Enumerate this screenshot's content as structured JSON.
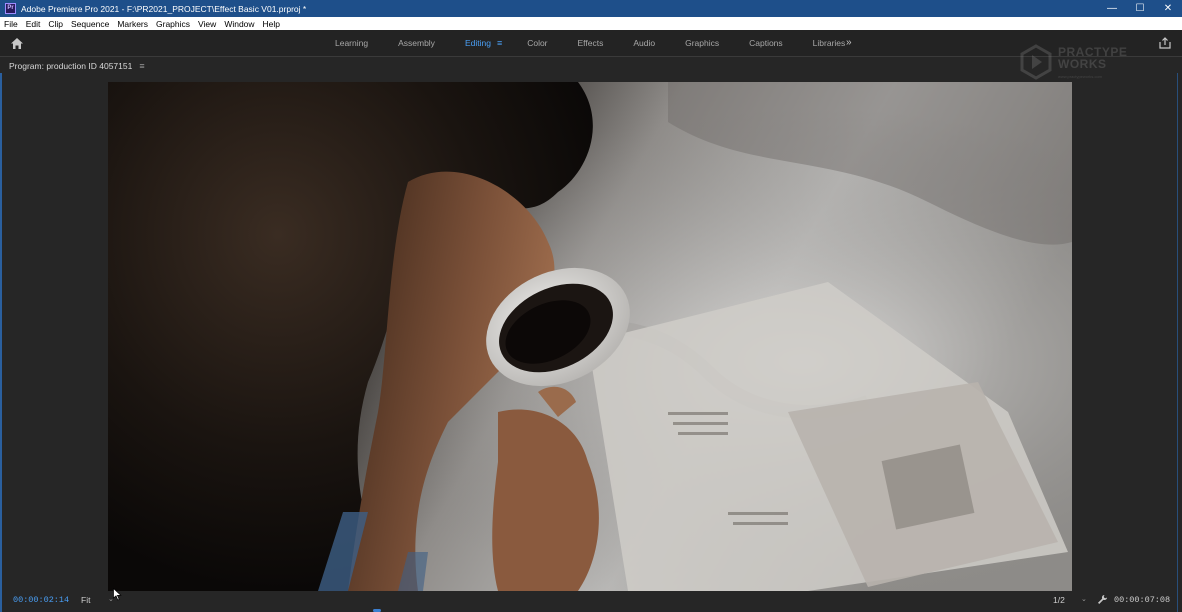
{
  "window": {
    "app_icon": "Pr",
    "title": "Adobe Premiere Pro 2021 - F:\\PR2021_PROJECT\\Effect Basic V01.prproj *",
    "controls": {
      "minimize": "—",
      "maximize": "☐",
      "close": "✕"
    }
  },
  "menu": [
    "File",
    "Edit",
    "Clip",
    "Sequence",
    "Markers",
    "Graphics",
    "View",
    "Window",
    "Help"
  ],
  "workspaces": {
    "tabs": [
      "Learning",
      "Assembly",
      "Editing",
      "Color",
      "Effects",
      "Audio",
      "Graphics",
      "Captions",
      "Libraries"
    ],
    "active": "Editing",
    "menu_glyph": "≡",
    "more_glyph": "»"
  },
  "program_monitor": {
    "tab_label": "Program: production ID 4057151",
    "menu_glyph": "≡",
    "current_timecode": "00:00:02:14",
    "zoom": "Fit",
    "resolution": "1/2",
    "duration_timecode": "00:00:07:08",
    "dropdown_glyph": "⌄"
  },
  "watermark": {
    "name": "PRACTYPE WORKS",
    "subtitle": "www.practypeworks.com"
  },
  "icons": {
    "home": "home-icon",
    "share": "share-icon",
    "wrench": "wrench-icon",
    "cursor": "mouse-cursor-icon"
  },
  "colors": {
    "accent": "#4a9ff5",
    "titlebar": "#1e4f8a",
    "panel": "#262626"
  }
}
